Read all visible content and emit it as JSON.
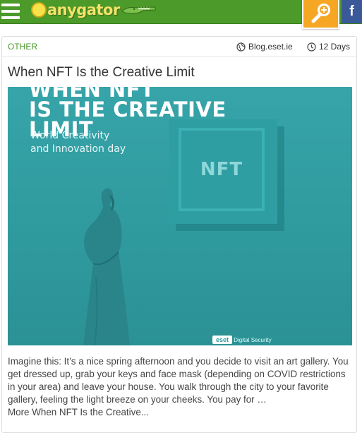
{
  "header": {
    "logo_text": "anygator",
    "colors": {
      "bar": "#4c9a2a",
      "search": "#f5a623",
      "facebook": "#3b5998"
    },
    "icons": [
      "menu-icon",
      "search-icon",
      "facebook-icon"
    ],
    "facebook_label": "f"
  },
  "article": {
    "category": "OTHER",
    "source": "Blog.eset.ie",
    "age": "12 Days",
    "title": "When NFT Is the Creative Limit",
    "image": {
      "headline_line1": "WHEN NFT",
      "headline_line2": "IS THE CREATIVE",
      "headline_line3": "LIMIT",
      "sub_line1": "World Creativity",
      "sub_line2": "and Innovation day",
      "stamp_text": "NFT",
      "brand": "eset",
      "brand_tag": "Digital Security"
    },
    "excerpt": "Imagine this: It’s a nice spring afternoon and you decide to visit an art gallery. You get dressed up, grab your keys and face mask (depending on COVID restrictions in your area) and leave your house. You walk through the city to your favorite gallery, feeling the light breeze on your cheeks. You pay for …",
    "more_link": "More When NFT Is the Creative..."
  }
}
